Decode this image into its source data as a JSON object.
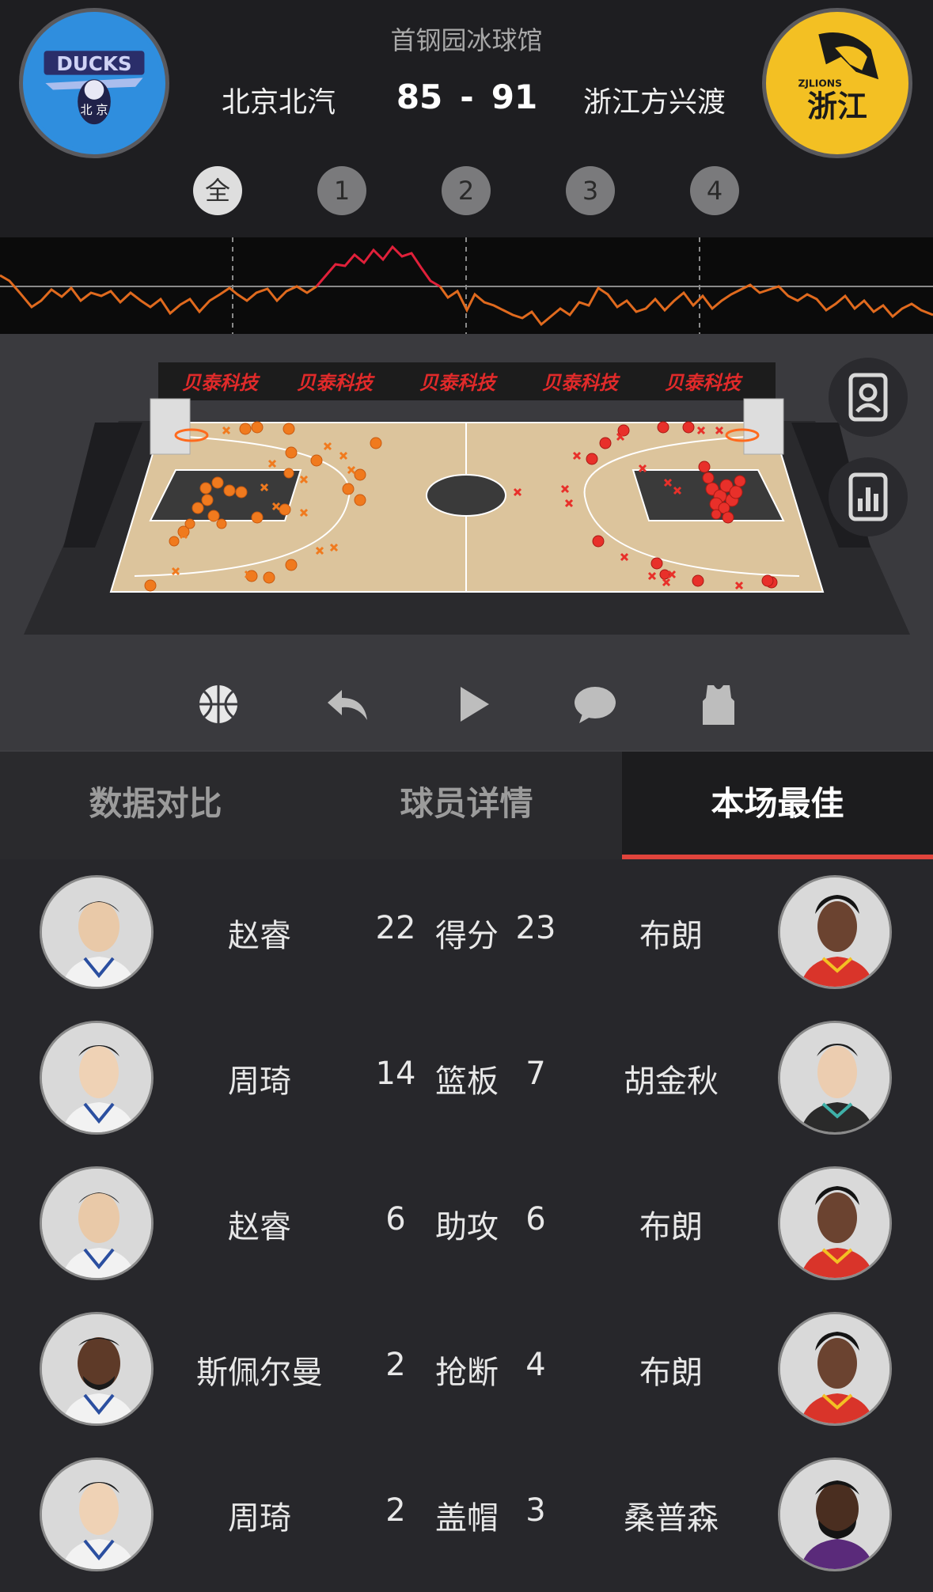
{
  "header": {
    "venue": "首钢园冰球馆",
    "home_team": "北京北汽",
    "away_team": "浙江方兴渡",
    "home_score": "85",
    "separator": "-",
    "away_score": "91",
    "home_logo_text": "DUCKS",
    "home_logo_sub": "北 京",
    "away_logo_text": "ZJLIONS",
    "away_logo_sub": "浙江"
  },
  "quarters": [
    {
      "label": "全",
      "active": true
    },
    {
      "label": "1",
      "active": false
    },
    {
      "label": "2",
      "active": false
    },
    {
      "label": "3",
      "active": false
    },
    {
      "label": "4",
      "active": false
    }
  ],
  "court": {
    "sponsor_board": [
      "贝泰科技",
      "贝泰科技",
      "贝泰科技",
      "贝泰科技",
      "贝泰科技"
    ]
  },
  "toolbar_icons": [
    "basketball-icon",
    "undo-icon",
    "play-icon",
    "comment-icon",
    "jersey-icon"
  ],
  "side_icons": [
    "player-card-icon",
    "stats-chart-icon"
  ],
  "tabs": [
    {
      "label": "数据对比",
      "active": false
    },
    {
      "label": "球员详情",
      "active": false
    },
    {
      "label": "本场最佳",
      "active": true
    }
  ],
  "best": [
    {
      "stat": "得分",
      "home_player": "赵睿",
      "home_value": "22",
      "away_player": "布朗",
      "away_value": "23"
    },
    {
      "stat": "篮板",
      "home_player": "周琦",
      "home_value": "14",
      "away_player": "胡金秋",
      "away_value": "7"
    },
    {
      "stat": "助攻",
      "home_player": "赵睿",
      "home_value": "6",
      "away_player": "布朗",
      "away_value": "6"
    },
    {
      "stat": "抢断",
      "home_player": "斯佩尔曼",
      "home_value": "2",
      "away_player": "布朗",
      "away_value": "4"
    },
    {
      "stat": "盖帽",
      "home_player": "周琦",
      "home_value": "2",
      "away_player": "桑普森",
      "away_value": "3"
    }
  ],
  "colors": {
    "accent": "#e0443c",
    "home_shot": "#f07a1e",
    "away_shot": "#e8302a",
    "home_logo_bg": "#2f8ede",
    "away_logo_bg": "#f3c023"
  }
}
